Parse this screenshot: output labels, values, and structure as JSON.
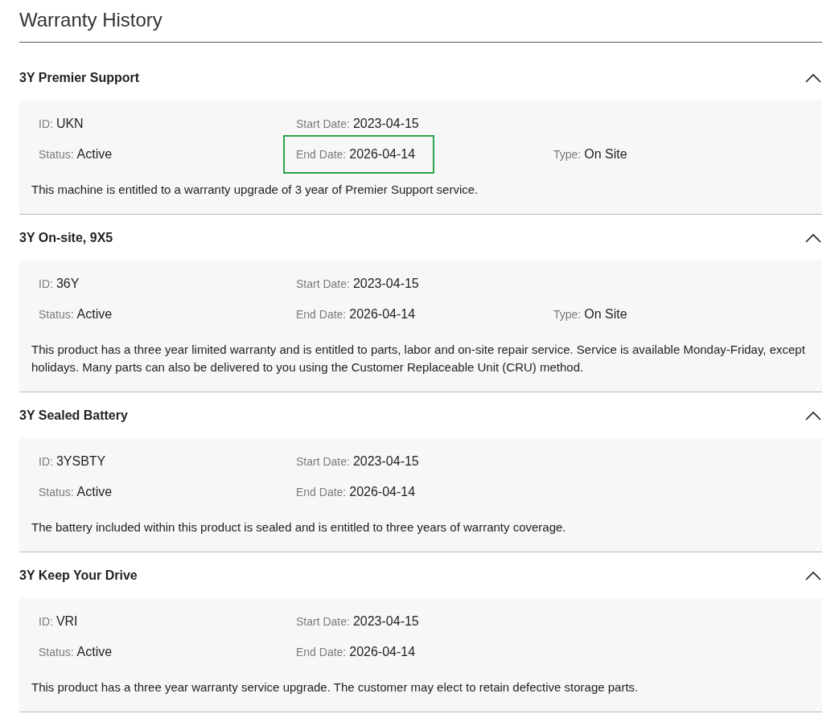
{
  "page_title": "Warranty History",
  "sections": [
    {
      "title": "3Y Premier Support",
      "expanded": true,
      "rows": [
        [
          {
            "label": "ID:",
            "value": "UKN",
            "highlighted": false
          },
          {
            "label": "Start Date:",
            "value": "2023-04-15",
            "highlighted": false
          }
        ],
        [
          {
            "label": "Status:",
            "value": "Active",
            "highlighted": false
          },
          {
            "label": "End Date:",
            "value": "2026-04-14",
            "highlighted": true
          },
          {
            "label": "Type:",
            "value": "On Site",
            "highlighted": false
          }
        ]
      ],
      "description": "This machine is entitled to a warranty upgrade of 3 year of Premier Support service."
    },
    {
      "title": "3Y On-site, 9X5",
      "expanded": true,
      "rows": [
        [
          {
            "label": "ID:",
            "value": "36Y",
            "highlighted": false
          },
          {
            "label": "Start Date:",
            "value": "2023-04-15",
            "highlighted": false
          }
        ],
        [
          {
            "label": "Status:",
            "value": "Active",
            "highlighted": false
          },
          {
            "label": "End Date:",
            "value": "2026-04-14",
            "highlighted": false
          },
          {
            "label": "Type:",
            "value": "On Site",
            "highlighted": false
          }
        ]
      ],
      "description": "This product has a three year limited warranty and is entitled to parts, labor and on-site repair service. Service is available Monday-Friday, except holidays. Many parts can also be delivered to you using the Customer Replaceable Unit (CRU) method."
    },
    {
      "title": "3Y Sealed Battery",
      "expanded": true,
      "rows": [
        [
          {
            "label": "ID:",
            "value": "3YSBTY",
            "highlighted": false
          },
          {
            "label": "Start Date:",
            "value": "2023-04-15",
            "highlighted": false
          }
        ],
        [
          {
            "label": "Status:",
            "value": "Active",
            "highlighted": false
          },
          {
            "label": "End Date:",
            "value": "2026-04-14",
            "highlighted": false
          }
        ]
      ],
      "description": "The battery included within this product is sealed and is entitled to three years of warranty coverage."
    },
    {
      "title": "3Y Keep Your Drive",
      "expanded": true,
      "rows": [
        [
          {
            "label": "ID:",
            "value": "VRI",
            "highlighted": false
          },
          {
            "label": "Start Date:",
            "value": "2023-04-15",
            "highlighted": false
          }
        ],
        [
          {
            "label": "Status:",
            "value": "Active",
            "highlighted": false
          },
          {
            "label": "End Date:",
            "value": "2026-04-14",
            "highlighted": false
          }
        ]
      ],
      "description": "This product has a three year warranty service upgrade. The customer may elect to retain defective storage parts."
    }
  ]
}
